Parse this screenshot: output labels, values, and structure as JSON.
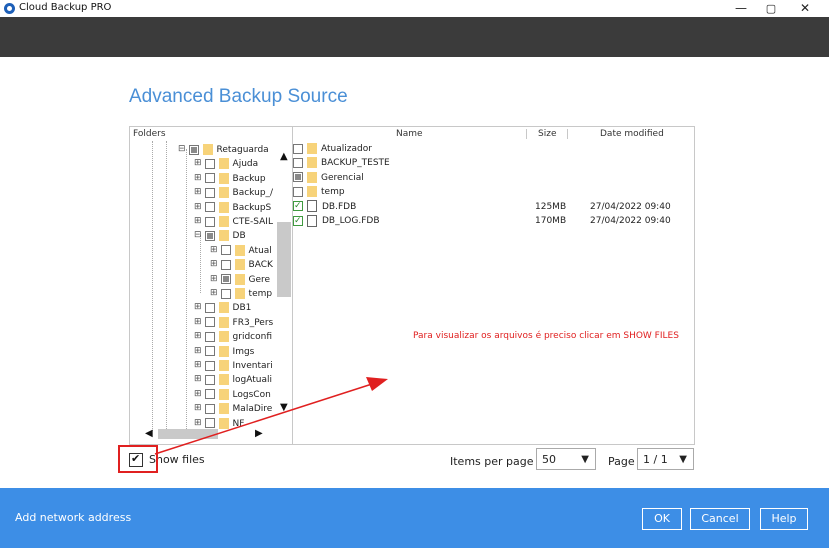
{
  "window": {
    "title": "Cloud Backup PRO",
    "minimize": "—",
    "maximize": "▢",
    "close": "✕"
  },
  "heading": "Advanced Backup Source",
  "panel": {
    "folders_header": "Folders",
    "name_header": "Name",
    "size_header": "Size",
    "date_header": "Date modified",
    "tree": [
      {
        "label": "Retaguarda",
        "expander": "⊟",
        "state": "partial"
      },
      {
        "label": "Ajuda",
        "expander": "⊞",
        "state": "unchecked"
      },
      {
        "label": "Backup",
        "expander": "⊞",
        "state": "unchecked"
      },
      {
        "label": "Backup_/",
        "expander": "⊞",
        "state": "unchecked"
      },
      {
        "label": "BackupS",
        "expander": "⊞",
        "state": "unchecked"
      },
      {
        "label": "CTE-SAIL",
        "expander": "⊞",
        "state": "unchecked"
      },
      {
        "label": "DB",
        "expander": "⊟",
        "state": "partial"
      },
      {
        "label": "Atual",
        "expander": "⊞",
        "state": "unchecked"
      },
      {
        "label": "BACK",
        "expander": "⊞",
        "state": "unchecked"
      },
      {
        "label": "Gere",
        "expander": "⊞",
        "state": "partial"
      },
      {
        "label": "temp",
        "expander": "⊞",
        "state": "unchecked"
      },
      {
        "label": "DB1",
        "expander": "⊞",
        "state": "unchecked"
      },
      {
        "label": "FR3_Pers",
        "expander": "⊞",
        "state": "unchecked"
      },
      {
        "label": "gridconfi",
        "expander": "⊞",
        "state": "unchecked"
      },
      {
        "label": "Imgs",
        "expander": "⊞",
        "state": "unchecked"
      },
      {
        "label": "Inventari",
        "expander": "⊞",
        "state": "unchecked"
      },
      {
        "label": "logAtuali",
        "expander": "⊞",
        "state": "unchecked"
      },
      {
        "label": "LogsCon",
        "expander": "⊞",
        "state": "unchecked"
      },
      {
        "label": "MalaDire",
        "expander": "⊞",
        "state": "unchecked"
      },
      {
        "label": "NF",
        "expander": "⊞",
        "state": "unchecked"
      }
    ],
    "files": [
      {
        "name": "Atualizador",
        "type": "folder",
        "state": "unchecked",
        "size": "",
        "date": ""
      },
      {
        "name": "BACKUP_TESTE",
        "type": "folder",
        "state": "unchecked",
        "size": "",
        "date": ""
      },
      {
        "name": "Gerencial",
        "type": "folder",
        "state": "partial",
        "size": "",
        "date": ""
      },
      {
        "name": "temp",
        "type": "folder",
        "state": "unchecked",
        "size": "",
        "date": ""
      },
      {
        "name": "DB.FDB",
        "type": "file",
        "state": "checked",
        "size": "125MB",
        "date": "27/04/2022 09:40"
      },
      {
        "name": "DB_LOG.FDB",
        "type": "file",
        "state": "checked",
        "size": "170MB",
        "date": "27/04/2022 09:40"
      }
    ],
    "scroll_up": "▲",
    "scroll_down": "▼",
    "scroll_left": "◀",
    "scroll_right": "▶"
  },
  "annotation": "Para visualizar os arquivos é preciso  clicar em SHOW FILES",
  "annotation_color": "#e02020",
  "controls": {
    "show_files_label": "Show files",
    "show_files_checked": true,
    "items_per_page_label": "Items per page",
    "items_per_page_value": "50",
    "page_label": "Page",
    "page_value": "1 / 1"
  },
  "footer": {
    "add_network": "Add network address",
    "ok": "OK",
    "cancel": "Cancel",
    "help": "Help",
    "background": "#3d8ee6"
  }
}
